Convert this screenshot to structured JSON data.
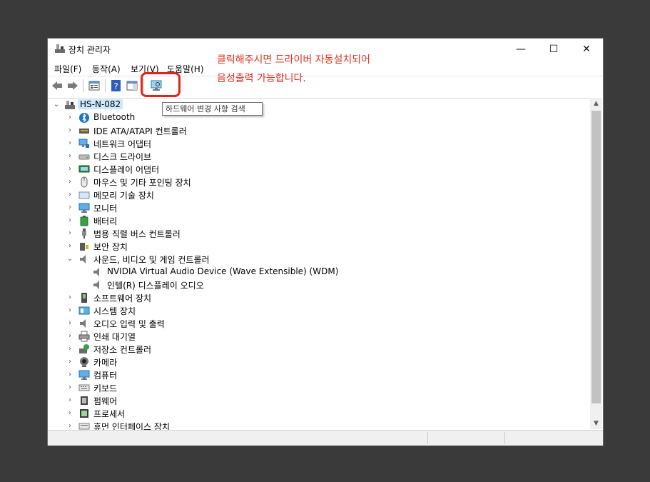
{
  "window": {
    "title": "장치 관리자",
    "controls": {
      "minimize": "—",
      "maximize": "☐",
      "close": "✕"
    }
  },
  "menu": [
    "파일(F)",
    "동작(A)",
    "보기(V)",
    "도움말(H)"
  ],
  "annotation": {
    "line1": "클릭해주시면 드라이버 자동설치되어",
    "line2": "음성출력 가능합니다.",
    "color": "#e0301e"
  },
  "tooltip": "하드웨어 변경 사항 검색",
  "tree": {
    "root": "HS-N-082",
    "items": [
      {
        "label": "Bluetooth",
        "icon": "bluetooth-icon",
        "expanded": false
      },
      {
        "label": "IDE ATA/ATAPI 컨트롤러",
        "icon": "ide-controller-icon",
        "expanded": false
      },
      {
        "label": "네트워크 어댑터",
        "icon": "network-adapter-icon",
        "expanded": false
      },
      {
        "label": "디스크 드라이브",
        "icon": "disk-drive-icon",
        "expanded": false
      },
      {
        "label": "디스플레이 어댑터",
        "icon": "display-adapter-icon",
        "expanded": false
      },
      {
        "label": "마우스 및 기타 포인팅 장치",
        "icon": "mouse-icon",
        "expanded": false
      },
      {
        "label": "메모리 기술 장치",
        "icon": "memory-device-icon",
        "expanded": false
      },
      {
        "label": "모니터",
        "icon": "monitor-icon",
        "expanded": false
      },
      {
        "label": "배터리",
        "icon": "battery-icon",
        "expanded": false
      },
      {
        "label": "범용 직렬 버스 컨트롤러",
        "icon": "usb-icon",
        "expanded": false
      },
      {
        "label": "보안 장치",
        "icon": "security-device-icon",
        "expanded": false
      },
      {
        "label": "사운드, 비디오 및 게임 컨트롤러",
        "icon": "speaker-icon",
        "expanded": true,
        "children": [
          "NVIDIA Virtual Audio Device (Wave Extensible) (WDM)",
          "인텔(R) 디스플레이 오디오"
        ]
      },
      {
        "label": "소프트웨어 장치",
        "icon": "software-device-icon",
        "expanded": false
      },
      {
        "label": "시스템 장치",
        "icon": "system-device-icon",
        "expanded": false
      },
      {
        "label": "오디오 입력 및 출력",
        "icon": "speaker-icon",
        "expanded": false
      },
      {
        "label": "인쇄 대기열",
        "icon": "printer-icon",
        "expanded": false
      },
      {
        "label": "저장소 컨트롤러",
        "icon": "storage-controller-icon",
        "expanded": false
      },
      {
        "label": "카메라",
        "icon": "camera-icon",
        "expanded": false
      },
      {
        "label": "컴퓨터",
        "icon": "computer-icon",
        "expanded": false
      },
      {
        "label": "키보드",
        "icon": "keyboard-icon",
        "expanded": false
      },
      {
        "label": "펌웨어",
        "icon": "firmware-icon",
        "expanded": false
      },
      {
        "label": "프로세서",
        "icon": "processor-icon",
        "expanded": false
      },
      {
        "label": "휴먼 인터페이스 장치",
        "icon": "hid-icon",
        "expanded": false
      }
    ]
  }
}
